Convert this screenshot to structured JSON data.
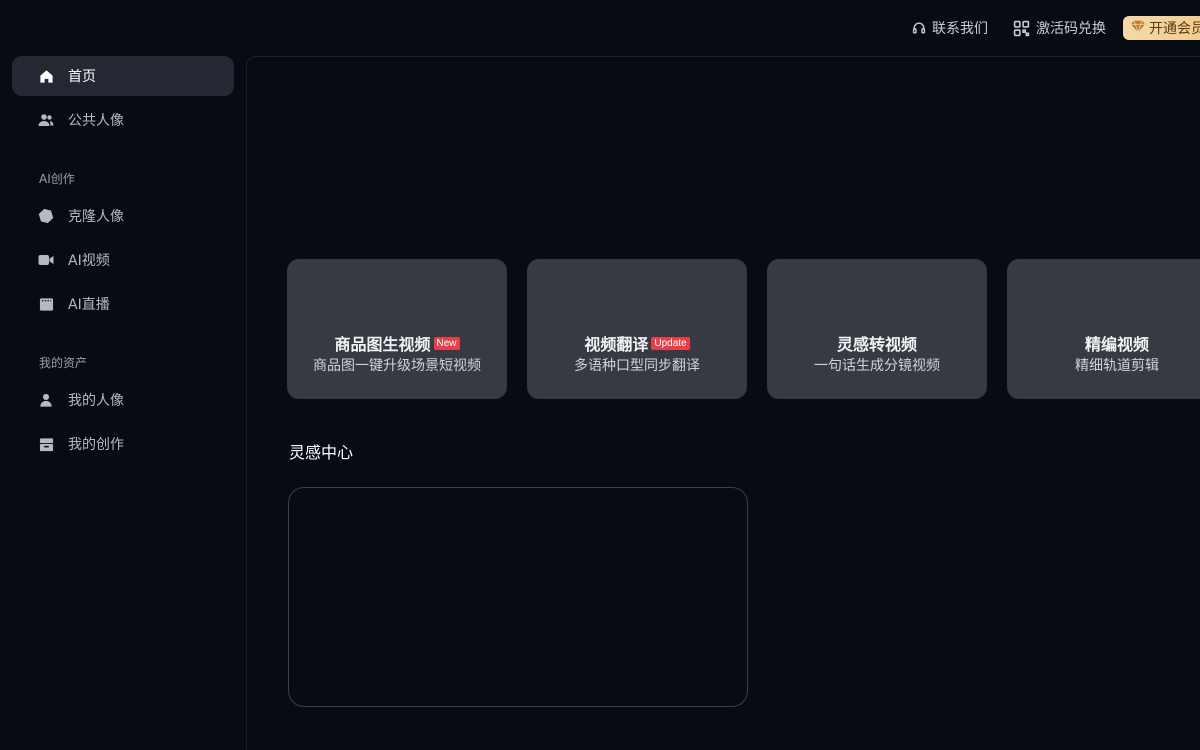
{
  "topbar": {
    "contact_label": "联系我们",
    "redeem_label": "激活码兑换",
    "vip_label": "开通会员"
  },
  "sidebar": {
    "items": [
      {
        "label": "首页",
        "icon": "home-icon",
        "active": true
      },
      {
        "label": "公共人像",
        "icon": "users-icon"
      }
    ],
    "sections": [
      {
        "title": "AI创作",
        "items": [
          {
            "label": "克隆人像",
            "icon": "hexagon-icon"
          },
          {
            "label": "AI视频",
            "icon": "video-camera-icon"
          },
          {
            "label": "AI直播",
            "icon": "live-stream-icon"
          }
        ]
      },
      {
        "title": "我的资产",
        "items": [
          {
            "label": "我的人像",
            "icon": "user-icon"
          },
          {
            "label": "我的创作",
            "icon": "archive-icon"
          }
        ]
      }
    ]
  },
  "main": {
    "cards": [
      {
        "title": "商品图生视频",
        "badge": "New",
        "subtitle": "商品图一键升级场景短视频"
      },
      {
        "title": "视频翻译",
        "badge": "Update",
        "subtitle": "多语种口型同步翻译"
      },
      {
        "title": "灵感转视频",
        "badge": "",
        "subtitle": "一句话生成分镜视频"
      },
      {
        "title": "精编视频",
        "badge": "",
        "subtitle": "精细轨道剪辑"
      }
    ],
    "inspiration_title": "灵感中心"
  },
  "colors": {
    "background": "#070b13",
    "card": "#373a42",
    "badge": "#e5404a",
    "vip_gradient_start": "#f4d9a8",
    "vip_gradient_end": "#f0c98a"
  }
}
